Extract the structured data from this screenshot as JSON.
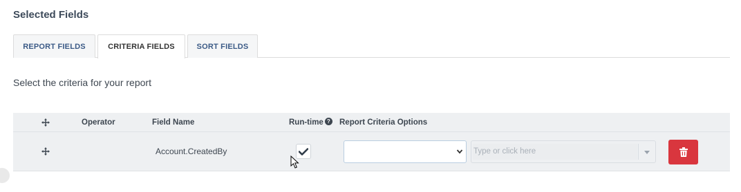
{
  "section_title": "Selected Fields",
  "tabs": [
    {
      "label": "REPORT FIELDS",
      "active": false
    },
    {
      "label": "CRITERIA FIELDS",
      "active": true
    },
    {
      "label": "SORT FIELDS",
      "active": false
    }
  ],
  "instruction": "Select the criteria for your report",
  "grid": {
    "headers": {
      "move_icon": "move-icon",
      "operator": "Operator",
      "field_name": "Field Name",
      "run_time": "Run-time",
      "run_time_help": "?",
      "report_criteria_options": "Report Criteria Options"
    },
    "rows": [
      {
        "move_icon": "move-icon",
        "operator": "",
        "field_name": "Account.CreatedBy",
        "run_time_checked": true,
        "criteria_option": "",
        "value_placeholder": "Type or click here",
        "delete_icon": "trash-icon"
      }
    ]
  },
  "colors": {
    "tab_text": "#3b5a86",
    "header_bg": "#eef0f2",
    "delete_button": "#d9363e",
    "select_border": "#b9cde0"
  }
}
